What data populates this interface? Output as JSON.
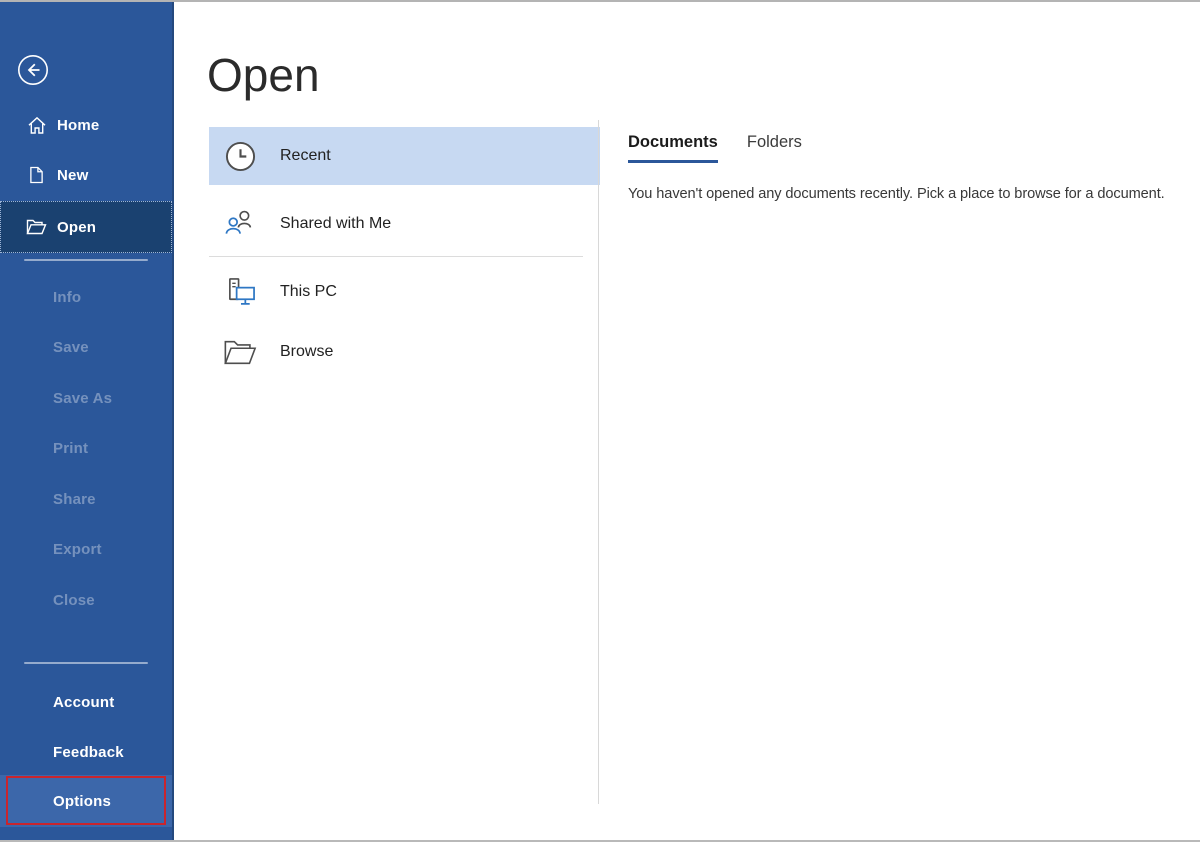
{
  "sidebar": {
    "items_top": [
      {
        "label": "Home",
        "selected": false
      },
      {
        "label": "New",
        "selected": false
      },
      {
        "label": "Open",
        "selected": true
      }
    ],
    "items_disabled": [
      "Info",
      "Save",
      "Save As",
      "Print",
      "Share",
      "Export",
      "Close"
    ],
    "items_bottom": [
      {
        "label": "Account",
        "highlighted": false
      },
      {
        "label": "Feedback",
        "highlighted": false
      },
      {
        "label": "Options",
        "highlighted": true,
        "annotated_with_red_box": true
      }
    ]
  },
  "main": {
    "title": "Open",
    "places": [
      {
        "label": "Recent",
        "icon": "clock-icon",
        "selected": true
      },
      {
        "label": "Shared with Me",
        "icon": "people-icon",
        "selected": false
      },
      {
        "label": "This PC",
        "icon": "pc-icon",
        "selected": false
      },
      {
        "label": "Browse",
        "icon": "browse-folder-icon",
        "selected": false
      }
    ]
  },
  "panel": {
    "tabs": [
      {
        "label": "Documents",
        "active": true
      },
      {
        "label": "Folders",
        "active": false
      }
    ],
    "empty_message": "You haven't opened any documents recently. Pick a place to browse for a document."
  },
  "colors": {
    "sidebar_background": "#2b579a",
    "sidebar_selected_item": "#1a4170",
    "options_highlight": "#3c67aa",
    "annotation_red": "#c9252d",
    "place_selected_background": "#c7d9f2",
    "tab_underline_blue": "#2b579a",
    "accent_icon_blue": "#2e77c4"
  }
}
